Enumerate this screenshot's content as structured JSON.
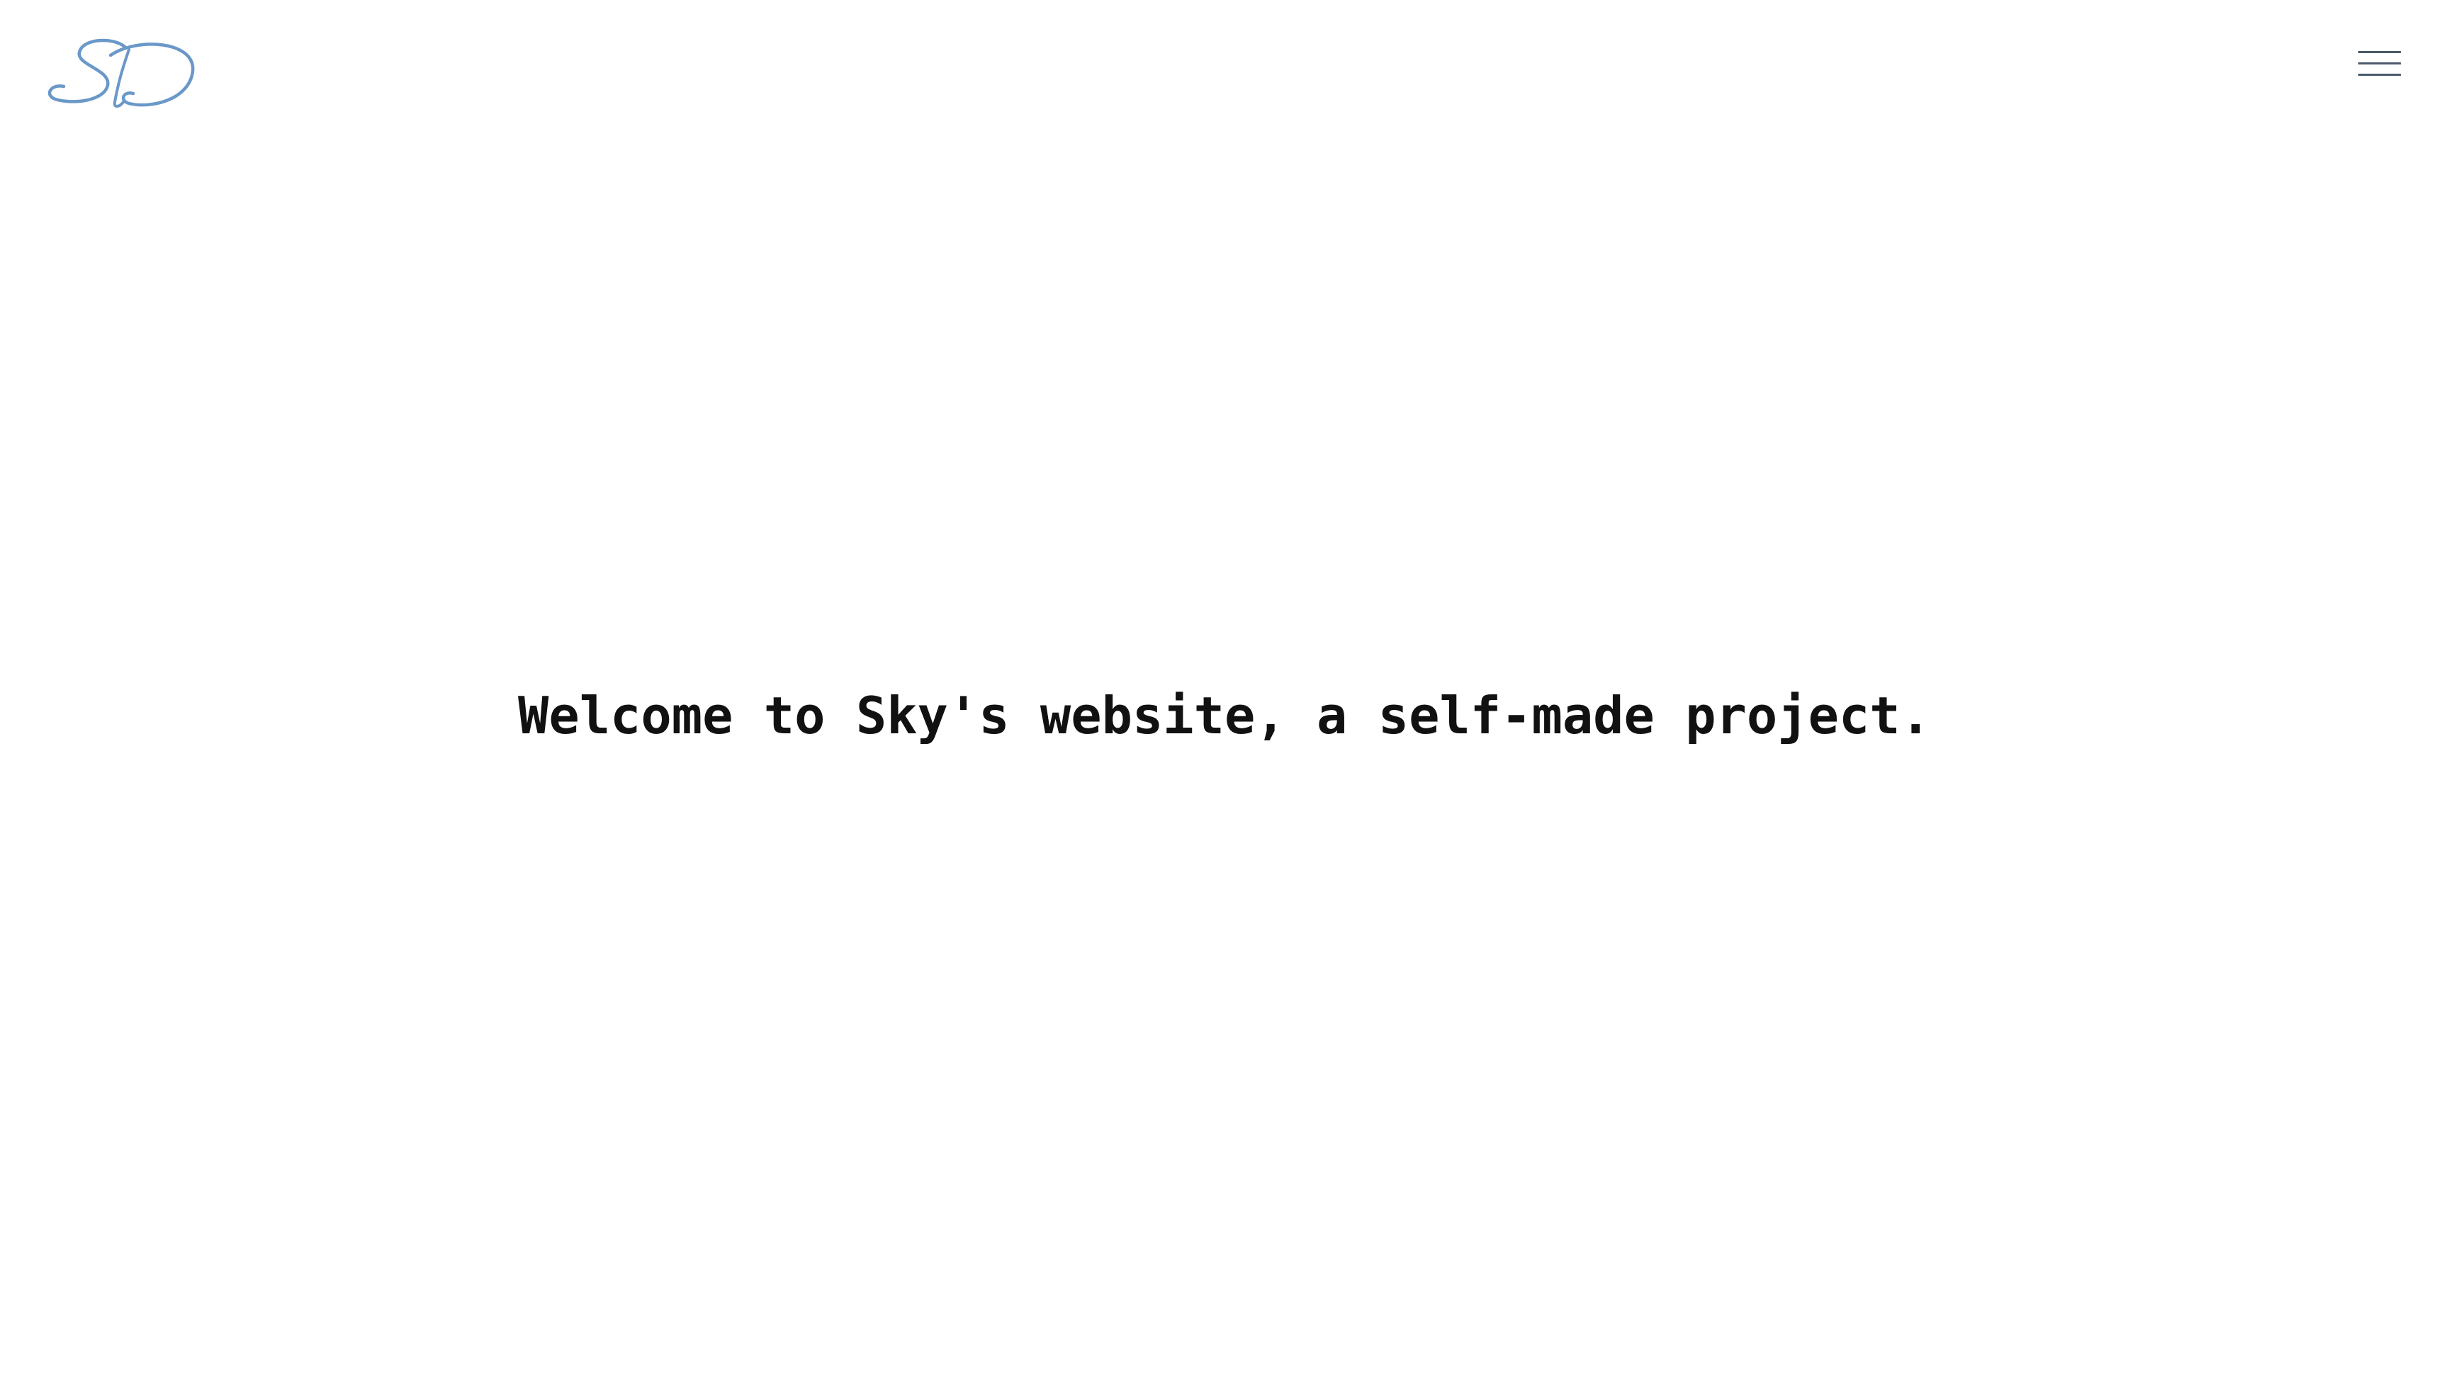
{
  "header": {
    "logo_text": "SD",
    "logo_color": "#6a98c8",
    "menu_icon": "hamburger-menu-icon"
  },
  "hero": {
    "title": "Welcome to Sky's website, a self-made project."
  }
}
